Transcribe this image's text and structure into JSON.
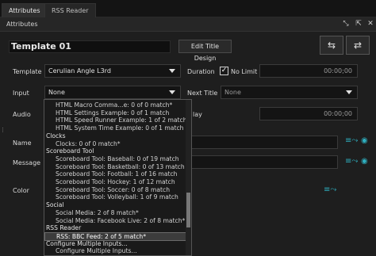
{
  "tabs": [
    {
      "label": "Attributes",
      "active": true
    },
    {
      "label": "RSS Reader",
      "active": false
    }
  ],
  "panel": {
    "title": "Attributes"
  },
  "header_icons": [
    "pin-icon",
    "pin-alt-icon",
    "close-icon"
  ],
  "title_field": {
    "value": "Template 01"
  },
  "buttons": {
    "edit_title_design": "Edit Title Design"
  },
  "labels": {
    "template": "Template",
    "input": "Input",
    "audio": "Audio",
    "name": "Name",
    "message": "Message",
    "color": "Color",
    "duration": "Duration",
    "next_title": "Next Title",
    "delay_partial": "lay"
  },
  "template_select": {
    "value": "Cerulian Angle L3rd"
  },
  "input_select": {
    "value": "None"
  },
  "duration": {
    "no_limit_label": "No Limit",
    "no_limit_checked": true,
    "timecode": "00:00;00"
  },
  "next_title_select": {
    "value": "None"
  },
  "delay": {
    "timecode": "00:00;00"
  },
  "dropdown": {
    "rows": [
      {
        "type": "item",
        "text": "HTML Macro Comma...e: 0 of 0 match*"
      },
      {
        "type": "item",
        "text": "HTML Settings Example: 0 of 1 match"
      },
      {
        "type": "item",
        "text": "HTML Speed Runner Example: 1 of 2 match"
      },
      {
        "type": "item",
        "text": "HTML System Time Example: 0 of 1 match"
      },
      {
        "type": "group",
        "text": "Clocks"
      },
      {
        "type": "item",
        "text": "Clocks: 0 of 0 match*"
      },
      {
        "type": "group",
        "text": "Scoreboard Tool"
      },
      {
        "type": "item",
        "text": "Scoreboard Tool: Baseball: 0 of 19 match"
      },
      {
        "type": "item",
        "text": "Scoreboard Tool: Basketball: 0 of 13 match"
      },
      {
        "type": "item",
        "text": "Scoreboard Tool: Football: 1 of 16 match"
      },
      {
        "type": "item",
        "text": "Scoreboard Tool: Hockey: 1 of 12 match"
      },
      {
        "type": "item",
        "text": "Scoreboard Tool: Soccer: 0 of 8 match"
      },
      {
        "type": "item",
        "text": "Scoreboard Tool: Volleyball: 1 of 9 match"
      },
      {
        "type": "group",
        "text": "Social"
      },
      {
        "type": "item",
        "text": "Social Media: 2 of 8 match*"
      },
      {
        "type": "item",
        "text": "Social Media: Facebook Live: 2 of 8 match*"
      },
      {
        "type": "group",
        "text": "RSS Reader"
      },
      {
        "type": "item",
        "text": "RSS: BBC Feed: 2 of 5 match*",
        "selected": true
      },
      {
        "type": "group",
        "text": "Configure Multiple Inputs..."
      },
      {
        "type": "item",
        "text": "Configure Multiple Inputs..."
      }
    ]
  },
  "colors": {
    "background": "#1e1e1e",
    "accent_teal": "#2fb0c0",
    "selected_row": "#3c3c3c"
  }
}
